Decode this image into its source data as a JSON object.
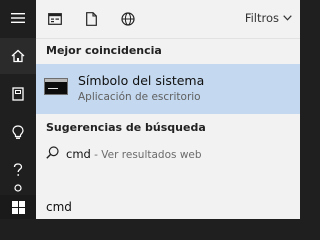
{
  "top_bar": {
    "filters_label": "Filtros"
  },
  "best_match": {
    "section_title": "Mejor coincidencia",
    "title": "Símbolo del sistema",
    "subtitle": "Aplicación de escritorio"
  },
  "suggestions": {
    "section_title": "Sugerencias de búsqueda",
    "items": [
      {
        "query": "cmd",
        "hint": "Ver resultados web"
      }
    ]
  },
  "search_box": {
    "value": "cmd"
  },
  "icons": {
    "rail": [
      "hamburger-icon",
      "home-icon",
      "notebook-icon",
      "lightbulb-icon",
      "help-icon",
      "user-icon"
    ],
    "top": [
      "apps-icon",
      "document-icon",
      "web-globe-icon",
      "chevron-down-icon"
    ],
    "taskbar": [
      "windows-logo-icon"
    ]
  },
  "colors": {
    "accent_selection": "#c4d9ef",
    "rail_background": "#1f1f1f",
    "panel_background": "#f2f2f2"
  }
}
